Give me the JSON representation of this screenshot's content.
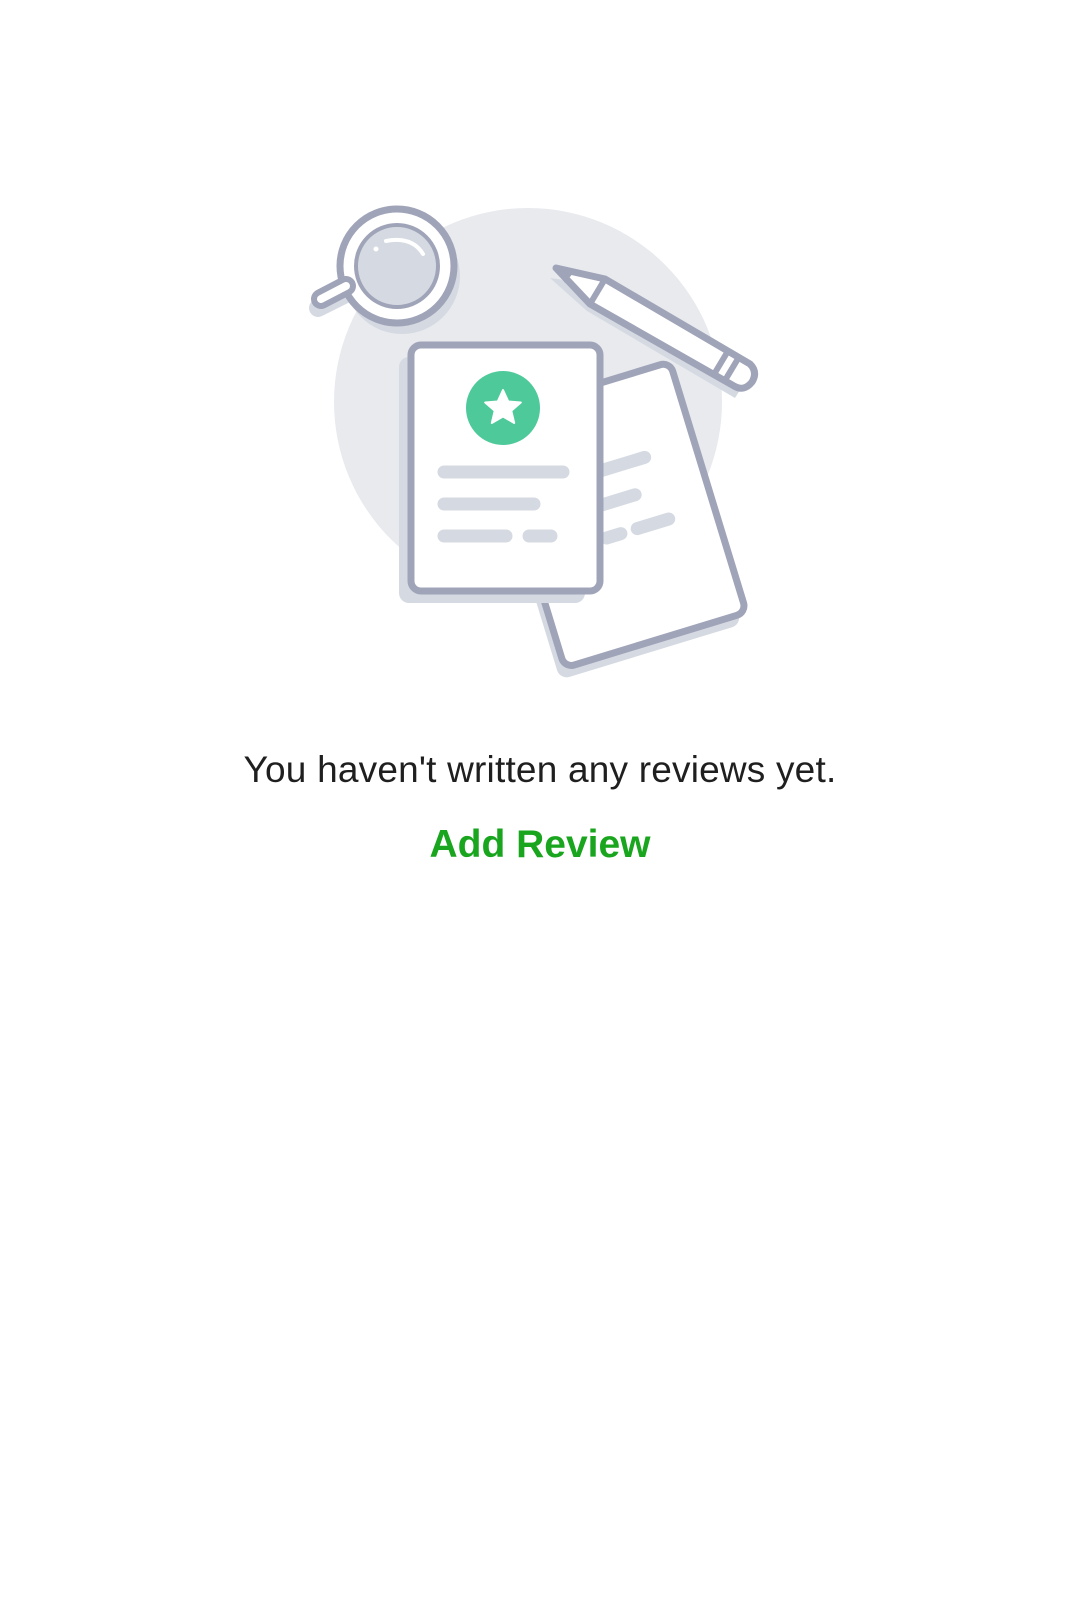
{
  "empty_state": {
    "illustration_icon": "review-documents-illustration",
    "message": "You haven't written any reviews yet.",
    "action_label": "Add Review"
  },
  "colors": {
    "background": "#ffffff",
    "message_text": "#1f1f1f",
    "action_green": "#1aa51f",
    "illustration_stroke": "#a0a4b8",
    "illustration_fill_light": "#e8eaee",
    "illustration_line": "#d5dae2",
    "star_badge": "#4ec99a"
  }
}
